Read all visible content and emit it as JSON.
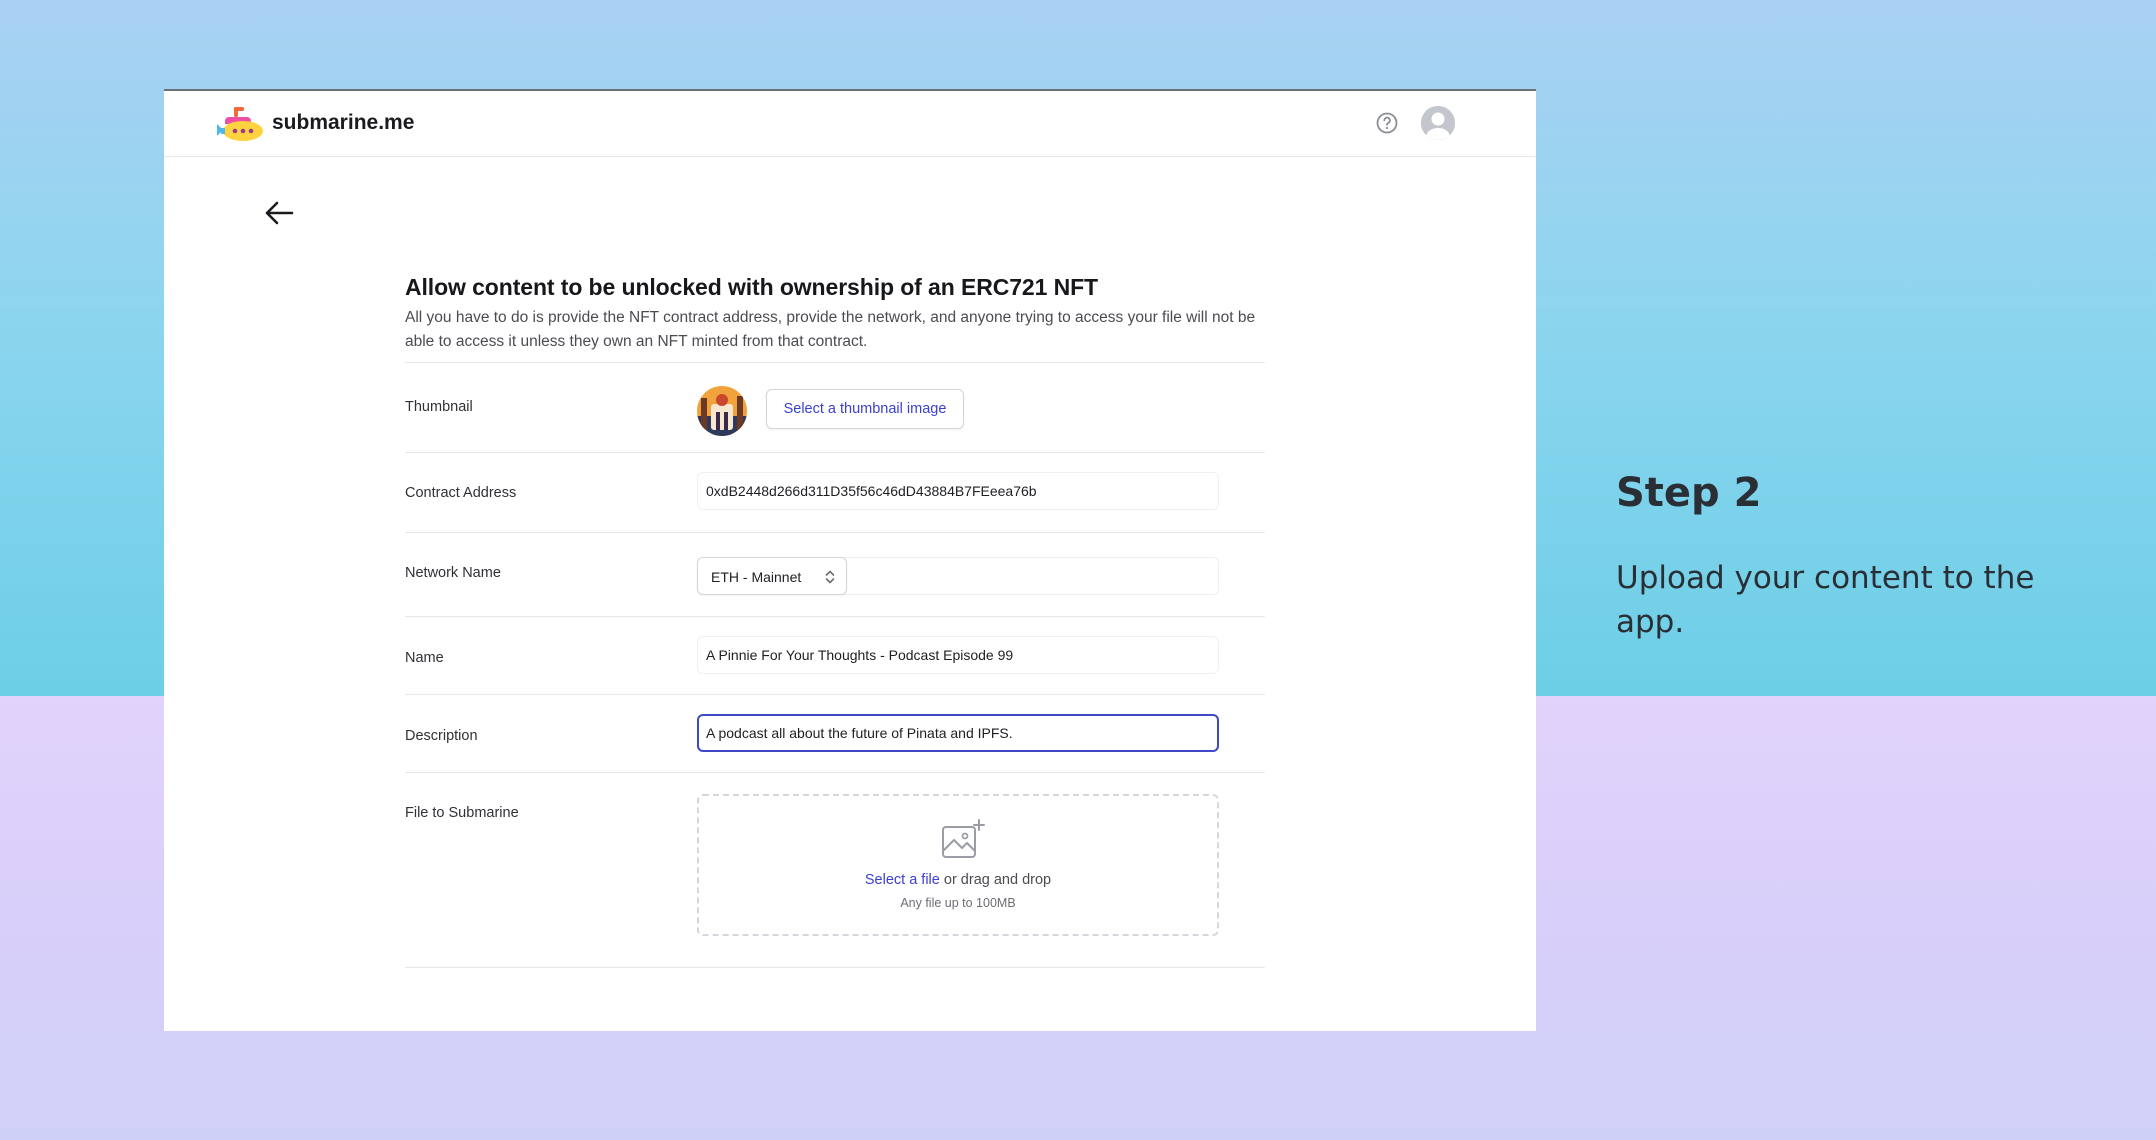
{
  "app": {
    "brand": "submarine.me"
  },
  "form": {
    "title": "Allow content to be unlocked with ownership of an ERC721 NFT",
    "description": "All you have to do is provide the NFT contract address, provide the network, and anyone trying to access your file will not be able to access it unless they own an NFT minted from that contract."
  },
  "fields": {
    "thumbnail": {
      "label": "Thumbnail",
      "button_label": "Select a thumbnail image"
    },
    "contract_address": {
      "label": "Contract Address",
      "value": "0xdB2448d266d311D35f56c46dD43884B7FEeea76b"
    },
    "network": {
      "label": "Network Name",
      "selected": "ETH - Mainnet"
    },
    "name": {
      "label": "Name",
      "value": "A Pinnie For Your Thoughts - Podcast Episode 99"
    },
    "description": {
      "label": "Description",
      "value": "A podcast all about the future of Pinata and IPFS."
    },
    "file": {
      "label": "File to Submarine",
      "link_text": "Select a file",
      "drop_text": " or drag and drop",
      "hint": "Any file up to 100MB"
    }
  },
  "side_panel": {
    "title": "Step 2",
    "text": "Upload your content to the app."
  },
  "colors": {
    "accent": "#3b3fd0",
    "focus_border": "#3f49c7",
    "background_top": "#8dd5ef",
    "background_bottom": "#dcd0fa"
  },
  "icons": {
    "logo": "submarine-logo-icon",
    "help": "question-circle-icon",
    "avatar": "user-avatar-icon",
    "back": "arrow-left-icon",
    "select_chevron": "chevron-up-down-icon",
    "upload": "image-plus-icon"
  }
}
